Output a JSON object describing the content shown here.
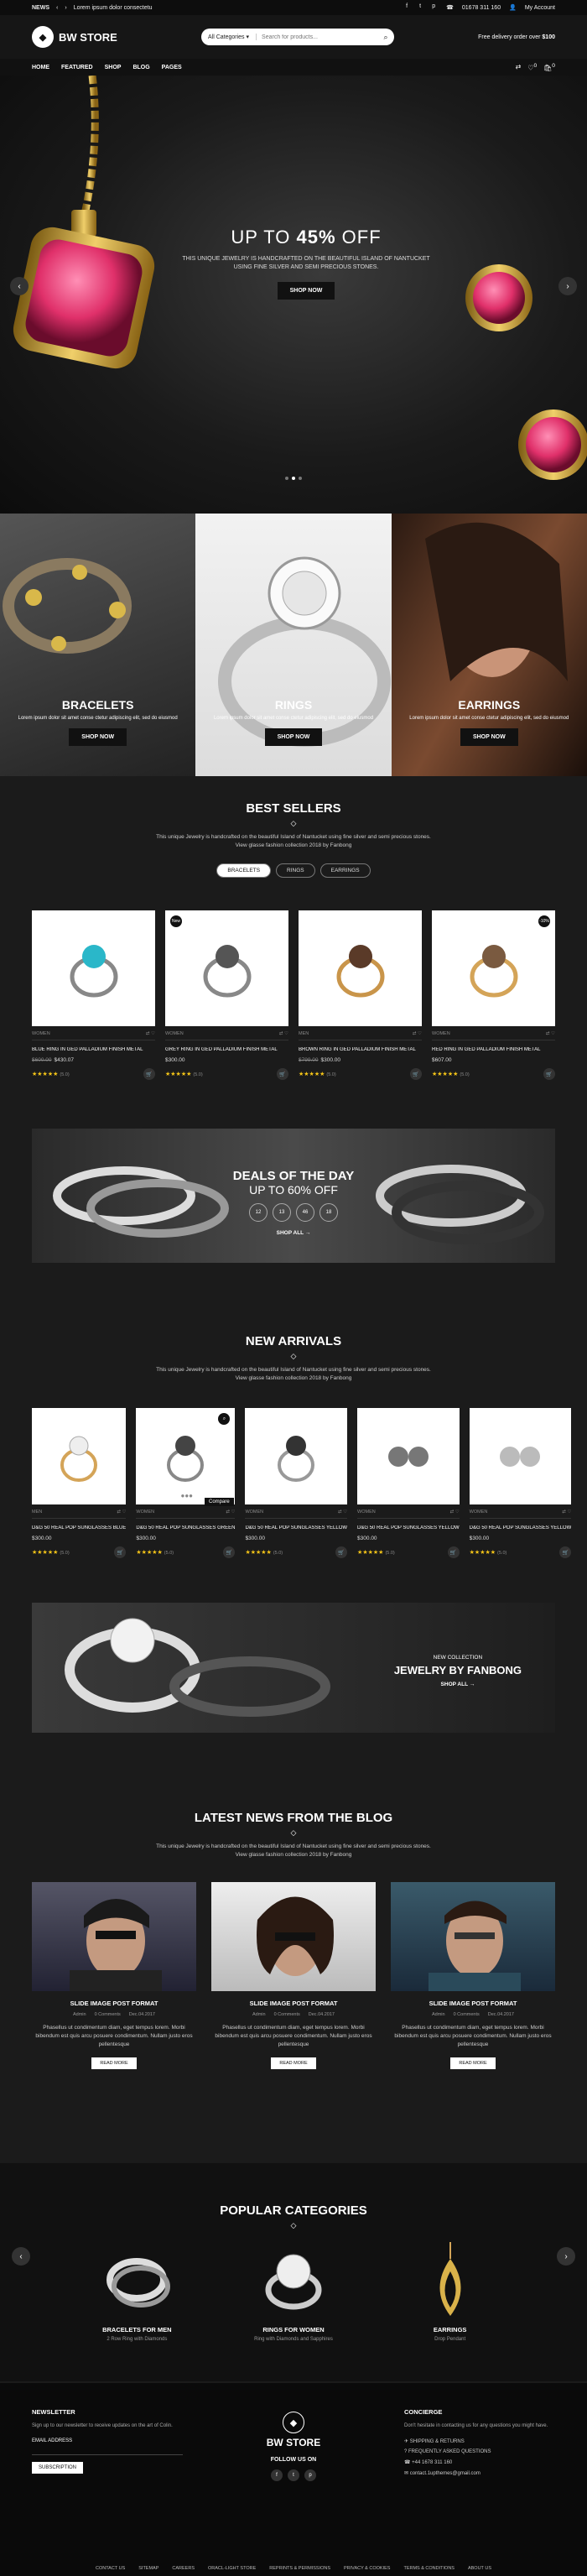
{
  "topbar": {
    "news_label": "NEWS",
    "news_text": "Lorem ipsum dolor consectetu",
    "phone": "01678 311 160",
    "account": "My Account"
  },
  "header": {
    "logo": "BW STORE",
    "category": "All Categories",
    "search_placeholder": "Search for products...",
    "free_delivery_prefix": "Free delivery order over",
    "free_delivery_amount": "$100"
  },
  "nav": {
    "items": [
      "HOME",
      "FEATURED",
      "SHOP",
      "BLOG",
      "PAGES"
    ],
    "cart_count": "0",
    "wish_count": "0"
  },
  "hero": {
    "title_prefix": "UP TO",
    "title_bold": "45%",
    "title_suffix": "OFF",
    "text": "THIS UNIQUE JEWELRY IS HANDCRAFTED ON THE BEAUTIFUL ISLAND OF NANTUCKET USING FINE SILVER AND SEMI PRECIOUS STONES.",
    "button": "SHOP NOW"
  },
  "categories": [
    {
      "title": "BRACELETS",
      "desc": "Lorem ipsum dolor sit amet conse ctetur adipiscing elit, sed do eiusmod",
      "button": "SHOP NOW"
    },
    {
      "title": "RINGS",
      "desc": "Lorem ipsum dolor sit amet conse ctetur adipiscing elit, sed do eiusmod",
      "button": "SHOP NOW"
    },
    {
      "title": "EARRINGS",
      "desc": "Lorem ipsum dolor sit amet conse ctetur adipiscing elit, sed do eiusmod",
      "button": "SHOP NOW"
    }
  ],
  "best_sellers": {
    "title": "BEST SELLERS",
    "sub1": "This unique Jewelry is handcrafted on the beautiful Island of Nantucket using fine silver and semi precious stones.",
    "sub2": "View glasse fashion collection 2018 by Fanbong",
    "tabs": [
      "BRACELETS",
      "RINGS",
      "EARRINGS"
    ],
    "products": [
      {
        "cat": "WOMEN",
        "name": "BLUE RING IN GED PALLADIUM FINISH METAL",
        "old": "$600.00",
        "price": "$430.07",
        "count": "(5.0)",
        "badge": ""
      },
      {
        "cat": "WOMEN",
        "name": "GREY RING IN GED PALLADIUM FINISH METAL",
        "old": "",
        "price": "$300.00",
        "count": "(5.0)",
        "badge": "New"
      },
      {
        "cat": "MEN",
        "name": "BROWN RING IN GED PALLADIUM FINISH METAL",
        "old": "$799.00",
        "price": "$300.00",
        "count": "(5.0)",
        "badge": ""
      },
      {
        "cat": "WOMEN",
        "name": "RED RING IN GED PALLADIUM FINISH METAL",
        "old": "",
        "price": "$607.00",
        "count": "(5.0)",
        "badge": "-10%"
      }
    ]
  },
  "deal": {
    "title1": "DEALS OF THE DAY",
    "title2": "UP TO 60% OFF",
    "timer": [
      "12",
      "13",
      "46",
      "18"
    ],
    "shop": "SHOP ALL"
  },
  "new_arrivals": {
    "title": "NEW ARRIVALS",
    "sub1": "This unique Jewelry is handcrafted on the beautiful Island of Nantucket using fine silver and semi precious stones.",
    "sub2": "View glasse fashion collection 2018 by Fanbong",
    "compare": "Compare",
    "products": [
      {
        "cat": "MEN",
        "name": "D&G 50 REAL POP SUNGLASSES BLUE",
        "price": "$300.00",
        "count": "(5.0)"
      },
      {
        "cat": "WOMEN",
        "name": "D&G 50 REAL POP SUNGLASSES GREEN",
        "price": "$300.00",
        "count": "(5.0)"
      },
      {
        "cat": "WOMEN",
        "name": "D&G 50 REAL POP SUNGLASSES YELLOW",
        "price": "$300.00",
        "count": "(5.0)"
      },
      {
        "cat": "WOMEN",
        "name": "D&G 50 REAL POP SUNGLASSES YELLOW",
        "price": "$300.00",
        "count": "(5.0)"
      },
      {
        "cat": "WOMEN",
        "name": "D&G 50 REAL POP SUNGLASSES YELLOW",
        "price": "$300.00",
        "count": "(5.0)"
      }
    ]
  },
  "collection": {
    "small": "NEW COLLECTION",
    "title": "JEWELRY BY FANBONG",
    "shop": "SHOP ALL"
  },
  "blog": {
    "title": "LATEST NEWS FROM THE BLOG",
    "sub1": "This unique Jewelry is handcrafted on the beautiful Island of Nantucket using fine silver and semi precious stones.",
    "sub2": "View glasse fashion collection 2018 by Fanbong",
    "posts": [
      {
        "title": "SLIDE IMAGE POST FORMAT",
        "author": "Admin",
        "comments": "0 Comments",
        "date": "Dec.04.2017",
        "desc": "Phasellus ut condimentum diam, eget tempus lorem. Morbi bibendum est quis arcu posuere condimentum. Nullam justo eros pellentesque",
        "btn": "READ MORE"
      },
      {
        "title": "SLIDE IMAGE POST FORMAT",
        "author": "Admin",
        "comments": "0 Comments",
        "date": "Dec.04.2017",
        "desc": "Phasellus ut condimentum diam, eget tempus lorem. Morbi bibendum est quis arcu posuere condimentum. Nullam justo eros pellentesque",
        "btn": "READ MORE"
      },
      {
        "title": "SLIDE IMAGE POST FORMAT",
        "author": "Admin",
        "comments": "0 Comments",
        "date": "Dec.04.2017",
        "desc": "Phasellus ut condimentum diam, eget tempus lorem. Morbi bibendum est quis arcu posuere condimentum. Nullam justo eros pellentesque",
        "btn": "READ MORE"
      }
    ]
  },
  "popular": {
    "title": "POPULAR CATEGORIES",
    "items": [
      {
        "name": "BRACELETS FOR MEN",
        "sub": "2 Row Ring with Diamonds"
      },
      {
        "name": "RINGS FOR WOMEN",
        "sub": "Ring with Diamonds and Sapphires"
      },
      {
        "name": "EARRINGS",
        "sub": "Drop Pendant"
      }
    ]
  },
  "footer": {
    "newsletter_title": "NEWSLETTER",
    "newsletter_text": "Sign up to our newsletter to receive updates on the art of Colin.",
    "email_label": "EMAIL ADDRESS",
    "subscribe": "SUBSCRIPTION",
    "logo": "BW STORE",
    "follow": "FOLLOW US ON",
    "concierge_title": "CONCIERGE",
    "concierge_text": "Don't hesitate in contacting us for any questions you might have.",
    "concierge_items": [
      "SHIPPING & RETURNS",
      "FREQUENTLY ASKED QUESTIONS",
      "+44 1678 311 160",
      "contact.1upthemes@gmail.com"
    ],
    "links": [
      "CONTACT US",
      "SITEMAP",
      "CAREERS",
      "ORACL-LIGHT STORE",
      "REPRINTS & PERMISSIONS",
      "PRIVACY & COOKIES",
      "TERMS & CONDITIONS",
      "ABOUT US"
    ]
  },
  "colors": {
    "bg": "#1b1b1b",
    "accent": "#ffffff",
    "star": "#f5c518"
  }
}
